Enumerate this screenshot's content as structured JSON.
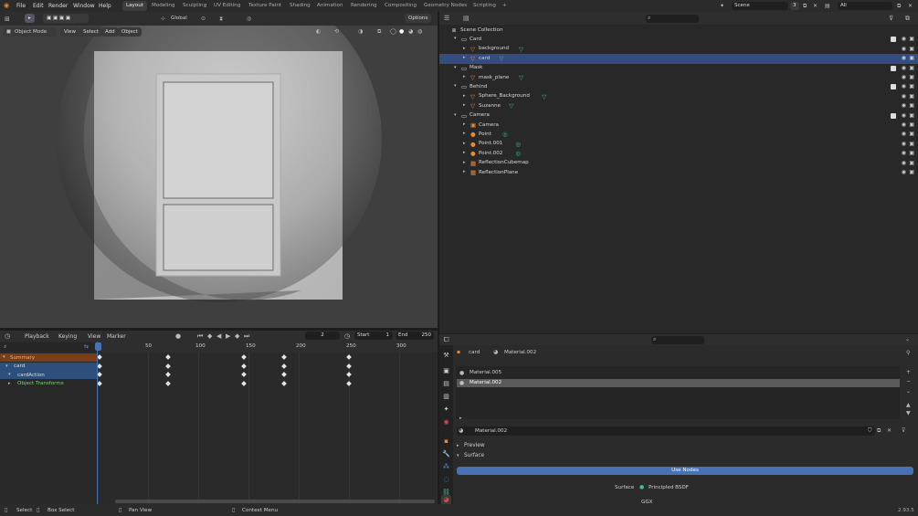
{
  "topbar": {
    "menus": [
      "File",
      "Edit",
      "Render",
      "Window",
      "Help"
    ],
    "workspaces": [
      "Layout",
      "Modeling",
      "Sculpting",
      "UV Editing",
      "Texture Paint",
      "Shading",
      "Animation",
      "Rendering",
      "Compositing",
      "Geometry Nodes",
      "Scripting"
    ],
    "active_workspace": "Layout",
    "add_tab": "+",
    "scene_label": "Scene",
    "scene_count": "3",
    "view_layer_label": "All"
  },
  "viewport": {
    "transform_orientation": "Global",
    "options_label": "Options",
    "mode": "Object Mode",
    "menus": [
      "View",
      "Select",
      "Add",
      "Object"
    ]
  },
  "outliner": {
    "search_placeholder": "",
    "rows": [
      {
        "label": "Scene Collection",
        "type": "scene",
        "depth": 0
      },
      {
        "label": "Card",
        "type": "collection",
        "depth": 1
      },
      {
        "label": "background",
        "type": "mesh",
        "depth": 2
      },
      {
        "label": "card",
        "type": "mesh",
        "depth": 2,
        "selected": true
      },
      {
        "label": "Mask",
        "type": "collection",
        "depth": 1
      },
      {
        "label": "mask_plane",
        "type": "mesh",
        "depth": 2
      },
      {
        "label": "Behind",
        "type": "collection",
        "depth": 1
      },
      {
        "label": "Sphere_Background",
        "type": "mesh",
        "depth": 2
      },
      {
        "label": "Suzanne",
        "type": "mesh",
        "depth": 2
      },
      {
        "label": "Camera",
        "type": "collection",
        "depth": 1
      },
      {
        "label": "Camera",
        "type": "camera",
        "depth": 2
      },
      {
        "label": "Point",
        "type": "light",
        "depth": 2
      },
      {
        "label": "Point.001",
        "type": "light",
        "depth": 2
      },
      {
        "label": "Point.002",
        "type": "light",
        "depth": 2
      },
      {
        "label": "ReflectionCubemap",
        "type": "probe",
        "depth": 2
      },
      {
        "label": "ReflectionPlane",
        "type": "probe",
        "depth": 2
      }
    ]
  },
  "timeline": {
    "menus": [
      "Playback",
      "Keying",
      "View",
      "Marker"
    ],
    "current_frame": "2",
    "start_label": "Start",
    "start_value": "1",
    "end_label": "End",
    "end_value": "250",
    "ruler": [
      "0",
      "50",
      "100",
      "150",
      "200",
      "250",
      "300"
    ],
    "channels": [
      {
        "label": "Summary",
        "color": "#7a3d1a"
      },
      {
        "label": "card",
        "color": "#2d4f7c"
      },
      {
        "label": "cardAction",
        "color": "#2d4f7c"
      },
      {
        "label": "Object Transforms",
        "color": "#282828"
      }
    ],
    "keyframe_frames": [
      2,
      70,
      145,
      185,
      250
    ]
  },
  "properties": {
    "object_name": "card",
    "material_name": "Material.002",
    "slots": [
      "Material.005",
      "Material.002"
    ],
    "active_slot": "Material.002",
    "datablock_name": "Material.002",
    "panels": [
      "Preview",
      "Surface"
    ],
    "use_nodes_label": "Use Nodes",
    "surface_label": "Surface",
    "surface_value": "Principled BSDF",
    "partial_label": "GGX"
  },
  "statusbar": {
    "items": [
      "Select",
      "Box Select",
      "Pan View",
      "Context Menu"
    ],
    "version": "2.93.5"
  },
  "colors": {
    "accent": "#4772b3",
    "selection": "#334d80",
    "key_orange": "#e8893a",
    "mesh_green": "#3fbf7f"
  }
}
